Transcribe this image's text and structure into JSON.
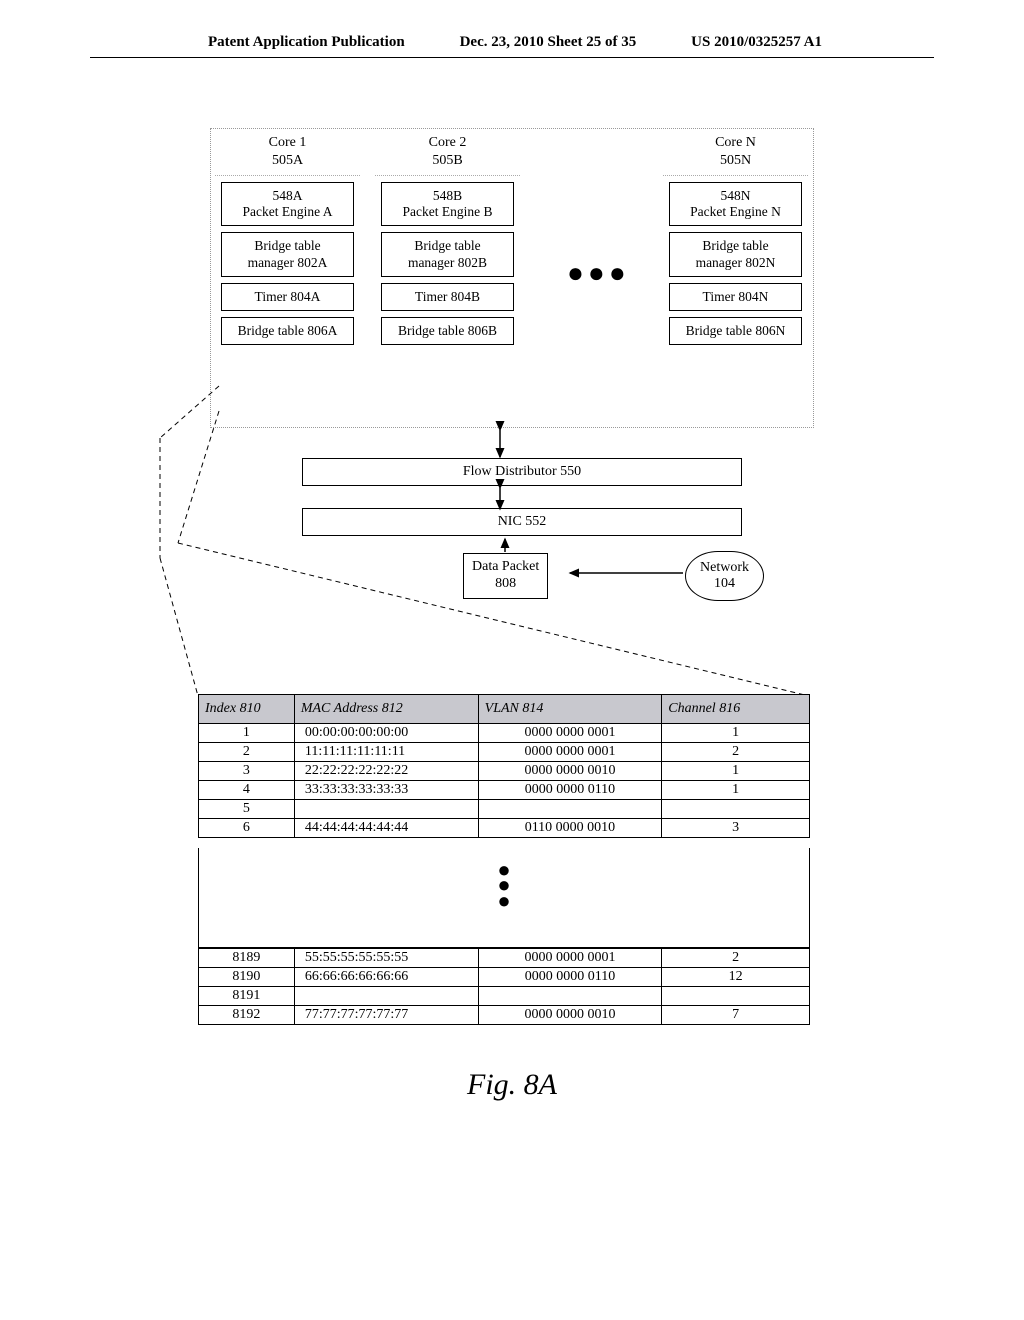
{
  "header": {
    "left": "Patent Application Publication",
    "center": "Dec. 23, 2010  Sheet 25 of 35",
    "right": "US 2010/0325257 A1"
  },
  "cores": {
    "c1": {
      "title1": "Core 1",
      "title2": "505A",
      "pe1": "548A",
      "pe2": "Packet Engine A",
      "btm1": "Bridge table",
      "btm2": "manager 802A",
      "timer": "Timer 804A",
      "bt": "Bridge table 806A"
    },
    "c2": {
      "title1": "Core 2",
      "title2": "505B",
      "pe1": "548B",
      "pe2": "Packet Engine B",
      "btm1": "Bridge table",
      "btm2": "manager 802B",
      "timer": "Timer 804B",
      "bt": "Bridge table 806B"
    },
    "cn": {
      "title1": "Core N",
      "title2": "505N",
      "pe1": "548N",
      "pe2": "Packet Engine N",
      "btm1": "Bridge table",
      "btm2": "manager 802N",
      "timer": "Timer 804N",
      "bt": "Bridge table 806N"
    }
  },
  "flow": {
    "fd": "Flow Distributor 550",
    "nic": "NIC 552",
    "dp1": "Data Packet",
    "dp2": "808",
    "net1": "Network",
    "net2": "104"
  },
  "table": {
    "h_index": "Index 810",
    "h_mac": "MAC Address 812",
    "h_vlan": "VLAN 814",
    "h_chan": "Channel 816",
    "top": [
      {
        "i": "1",
        "m": "00:00:00:00:00:00",
        "v": "0000 0000 0001",
        "c": "1"
      },
      {
        "i": "2",
        "m": "11:11:11:11:11:11",
        "v": "0000 0000 0001",
        "c": "2"
      },
      {
        "i": "3",
        "m": "22:22:22:22:22:22",
        "v": "0000 0000 0010",
        "c": "1"
      },
      {
        "i": "4",
        "m": "33:33:33:33:33:33",
        "v": "0000 0000 0110",
        "c": "1"
      },
      {
        "i": "5",
        "m": "",
        "v": "",
        "c": ""
      },
      {
        "i": "6",
        "m": "44:44:44:44:44:44",
        "v": "0110 0000 0010",
        "c": "3"
      }
    ],
    "bot": [
      {
        "i": "8189",
        "m": "55:55:55:55:55:55",
        "v": "0000 0000 0001",
        "c": "2"
      },
      {
        "i": "8190",
        "m": "66:66:66:66:66:66",
        "v": "0000 0000 0110",
        "c": "12"
      },
      {
        "i": "8191",
        "m": "",
        "v": "",
        "c": ""
      },
      {
        "i": "8192",
        "m": "77:77:77:77:77:77",
        "v": "0000 0000 0010",
        "c": "7"
      }
    ]
  },
  "figure_label": "Fig. 8A"
}
